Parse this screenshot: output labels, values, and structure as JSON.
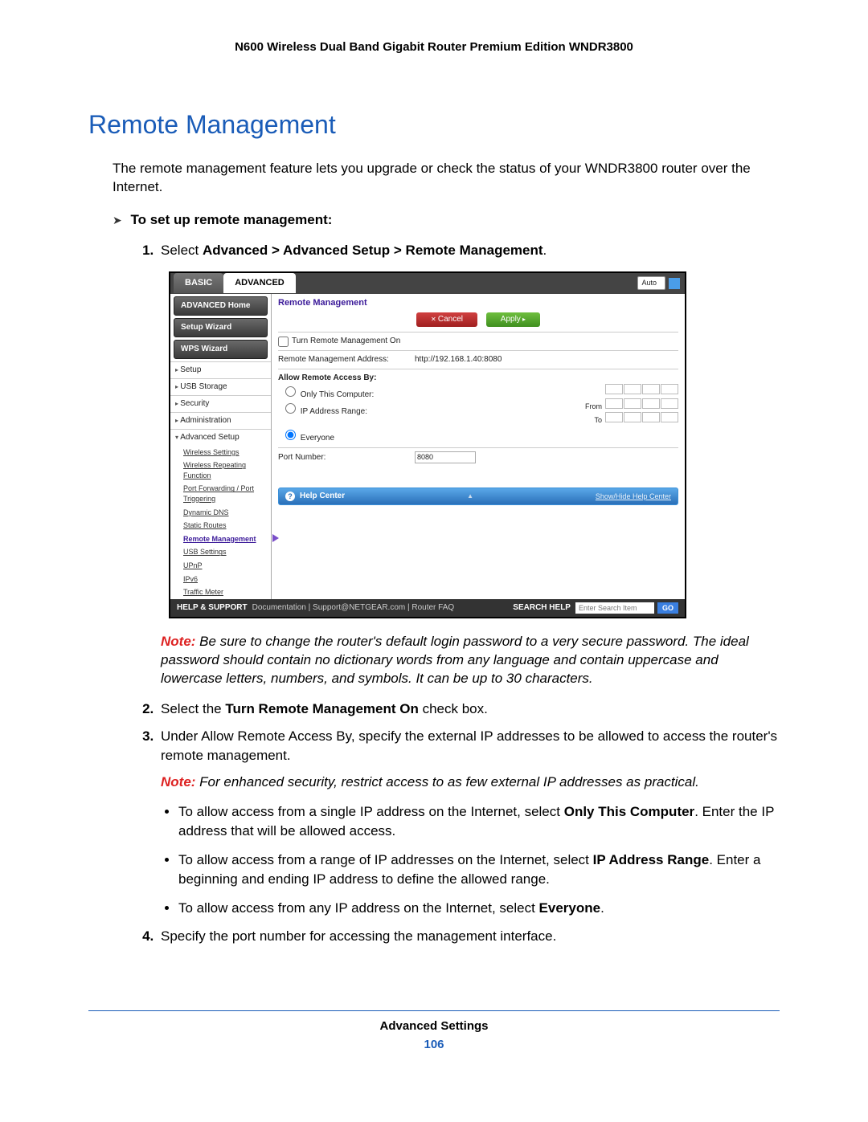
{
  "doc_header": "N600 Wireless Dual Band Gigabit Router Premium Edition WNDR3800",
  "section_title": "Remote Management",
  "intro": "The remote management feature lets you upgrade or check the status of your WNDR3800 router over the Internet.",
  "task_heading": "To set up remote management:",
  "step1": {
    "prefix": "Select ",
    "bold": "Advanced > Advanced Setup > Remote Management",
    "suffix": "."
  },
  "note1": {
    "label": "Note:",
    "text": "  Be sure to change the router's default login password to a very secure password. The ideal password should contain no dictionary words from any language and contain uppercase and lowercase letters, numbers, and symbols. It can be up to 30 characters."
  },
  "step2": {
    "prefix": "Select the ",
    "bold": "Turn Remote Management On",
    "suffix": " check box."
  },
  "step3": "Under Allow Remote Access By, specify the external IP addresses to be allowed to access the router's remote management.",
  "note2": {
    "label": "Note:",
    "text": "  For enhanced security, restrict access to as few external IP addresses as practical."
  },
  "bullets": {
    "b1p1": "To allow access from a single IP address on the Internet, select ",
    "b1b": "Only This Computer",
    "b1p2": ". Enter the IP address that will be allowed access.",
    "b2p1": "To allow access from a range of IP addresses on the Internet, select ",
    "b2b": "IP Address Range",
    "b2p2": ". Enter a beginning and ending IP address to define the allowed range.",
    "b3p1": "To allow access from any IP address on the Internet, select ",
    "b3b": "Everyone",
    "b3p2": "."
  },
  "step4": "Specify the port number for accessing the management interface.",
  "footer_section": "Advanced Settings",
  "footer_page": "106",
  "ui": {
    "tabs": {
      "basic": "BASIC",
      "advanced": "ADVANCED"
    },
    "auto": "Auto",
    "side_buttons": [
      "ADVANCED Home",
      "Setup Wizard",
      "WPS Wizard"
    ],
    "side_items": [
      "Setup",
      "USB Storage",
      "Security",
      "Administration"
    ],
    "side_exp": "Advanced Setup",
    "side_subs": [
      "Wireless Settings",
      "Wireless Repeating Function",
      "Port Forwarding / Port Triggering",
      "Dynamic DNS",
      "Static Routes"
    ],
    "side_active": "Remote Management",
    "side_subs2": [
      "USB Settings",
      "UPnP",
      "IPv6",
      "Traffic Meter"
    ],
    "main_title": "Remote Management",
    "btn_cancel": "Cancel",
    "btn_apply": "Apply",
    "chk_label": "Turn Remote Management On",
    "addr_label": "Remote Management Address:",
    "addr_value": "http://192.168.1.40:8080",
    "allow_label": "Allow Remote Access By:",
    "opt_only": "Only This Computer:",
    "opt_range": "IP Address Range:",
    "opt_every": "Everyone",
    "from": "From",
    "to": "To",
    "port_label": "Port Number:",
    "port_value": "8080",
    "help_center": "Help Center",
    "show_hide": "Show/Hide Help Center",
    "help_support": "HELP & SUPPORT",
    "help_links": "Documentation | Support@NETGEAR.com | Router FAQ",
    "search_label": "SEARCH HELP",
    "search_placeholder": "Enter Search Item",
    "go": "GO"
  }
}
